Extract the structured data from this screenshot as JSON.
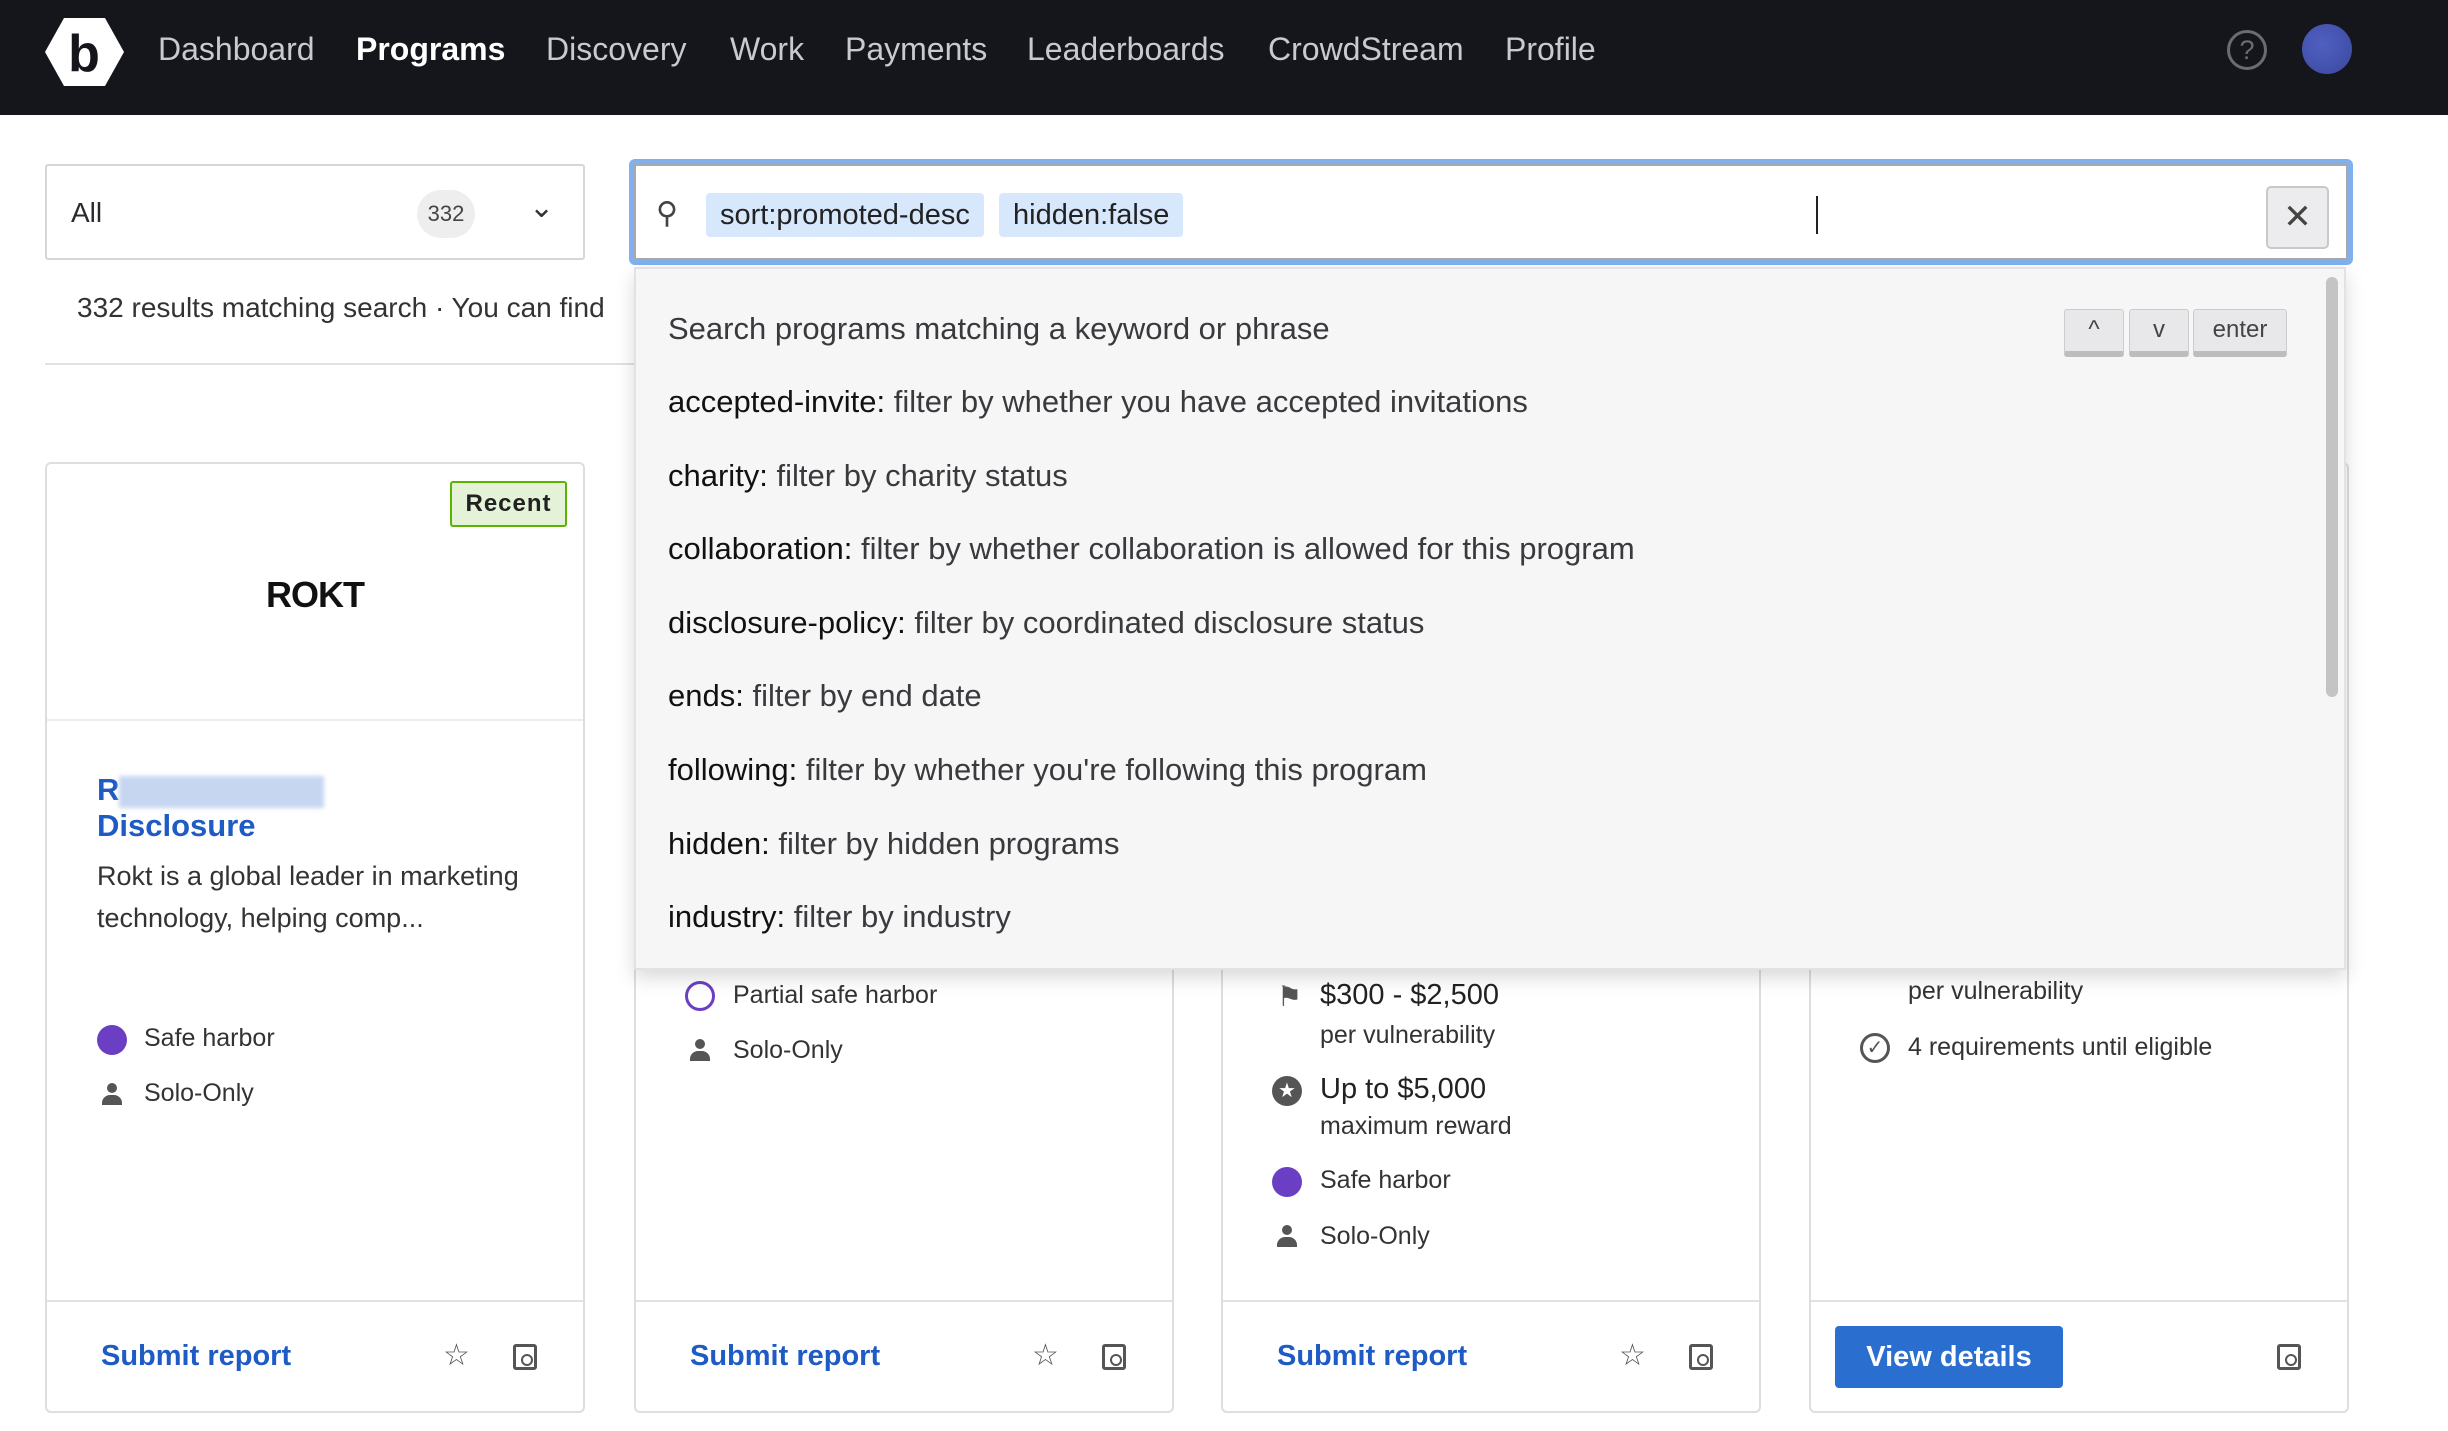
{
  "nav": {
    "items": [
      "Dashboard",
      "Programs",
      "Discovery",
      "Work",
      "Payments",
      "Leaderboards",
      "CrowdStream",
      "Profile"
    ],
    "active": "Programs",
    "logo_letter": "b",
    "help_icon": "?"
  },
  "filter": {
    "selected": "All",
    "count": "332"
  },
  "search": {
    "chips": [
      "sort:promoted-desc",
      "hidden:false"
    ],
    "clear_icon": "✕"
  },
  "results_text": "332 results matching search · You can find",
  "dropdown": {
    "header": "Search programs matching a keyword or phrase",
    "keys": [
      "^",
      "v",
      "enter"
    ],
    "items": [
      {
        "key": "accepted-invite:",
        "desc": " filter by whether you have accepted invitations"
      },
      {
        "key": "charity:",
        "desc": " filter by charity status"
      },
      {
        "key": "collaboration:",
        "desc": " filter by whether collaboration is allowed for this program"
      },
      {
        "key": "disclosure-policy:",
        "desc": " filter by coordinated disclosure status"
      },
      {
        "key": "ends:",
        "desc": " filter by end date"
      },
      {
        "key": "following:",
        "desc": " filter by whether you're following this program"
      },
      {
        "key": "hidden:",
        "desc": " filter by hidden programs"
      },
      {
        "key": "industry:",
        "desc": " filter by industry"
      }
    ]
  },
  "cards": [
    {
      "badge": "Recent",
      "logo": "ROKT",
      "title_start": "R",
      "title_end": "Disclosure",
      "description": "Rokt is a global leader in marketing technology, helping comp...",
      "features": [
        "Safe harbor",
        "Solo-Only"
      ],
      "action": "Submit report"
    },
    {
      "features": [
        "Partial safe harbor",
        "Solo-Only"
      ],
      "action": "Submit report"
    },
    {
      "reward_range": "$300 - $2,500",
      "reward_range_sub": "per vulnerability",
      "max_reward": "Up to $5,000",
      "max_reward_sub": "maximum reward",
      "features": [
        "Safe harbor",
        "Solo-Only"
      ],
      "action": "Submit report"
    },
    {
      "reward_sub": "per vulnerability",
      "requirements": "4 requirements until eligible",
      "action": "View details"
    }
  ],
  "colors": {
    "nav_bg": "#15161b",
    "link": "#1f5bc4",
    "button": "#2a6fd0",
    "badge_bg": "#e4f3d8",
    "badge_border": "#5cb200",
    "chip": "#d8e8fc",
    "shield": "#6b3fc4"
  }
}
